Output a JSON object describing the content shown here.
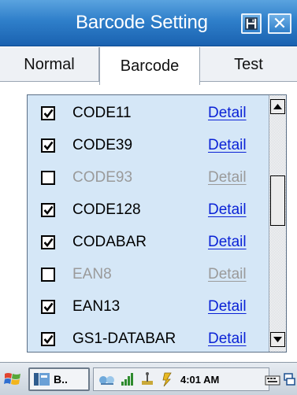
{
  "window": {
    "title": "Barcode Setting",
    "close_label": "✕"
  },
  "tabs": [
    {
      "label": "Normal",
      "selected": false
    },
    {
      "label": "Barcode",
      "selected": true
    },
    {
      "label": "Test",
      "selected": false
    }
  ],
  "barcodes": [
    {
      "name": "CODE11",
      "checked": true,
      "enabled": true,
      "detail": "Detail"
    },
    {
      "name": "CODE39",
      "checked": true,
      "enabled": true,
      "detail": "Detail"
    },
    {
      "name": "CODE93",
      "checked": false,
      "enabled": false,
      "detail": "Detail"
    },
    {
      "name": "CODE128",
      "checked": true,
      "enabled": true,
      "detail": "Detail"
    },
    {
      "name": "CODABAR",
      "checked": true,
      "enabled": true,
      "detail": "Detail"
    },
    {
      "name": "EAN8",
      "checked": false,
      "enabled": false,
      "detail": "Detail"
    },
    {
      "name": "EAN13",
      "checked": true,
      "enabled": true,
      "detail": "Detail"
    },
    {
      "name": "GS1-DATABAR",
      "checked": true,
      "enabled": true,
      "detail": "Detail"
    }
  ],
  "taskbar": {
    "task_label": "B..",
    "clock": "4:01 AM"
  },
  "colors": {
    "title_bar": "#2f7fca",
    "list_background": "#d5e7f7",
    "link": "#0a22d6",
    "disabled_text": "#9a9a9a"
  }
}
